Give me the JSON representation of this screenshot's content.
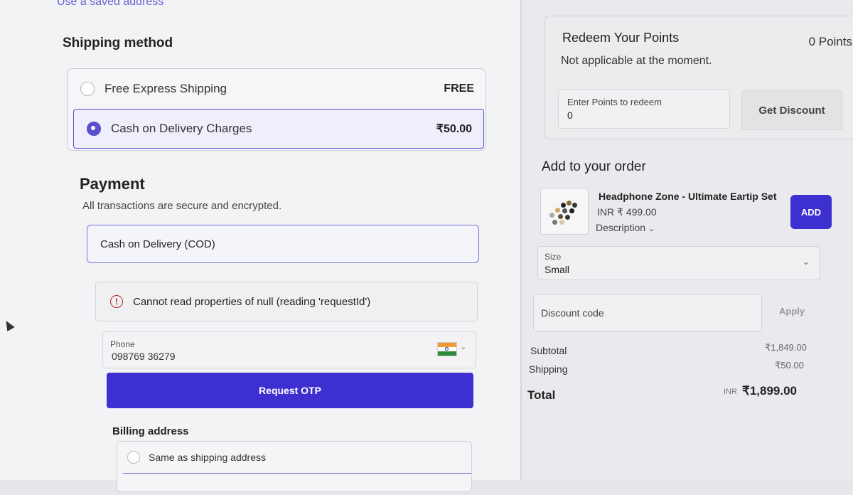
{
  "top_link": "Use a saved address",
  "shipping": {
    "title": "Shipping method",
    "options": [
      {
        "label": "Free Express Shipping",
        "price": "FREE",
        "selected": false
      },
      {
        "label": "Cash on Delivery Charges",
        "price": "₹50.00",
        "selected": true
      }
    ]
  },
  "payment": {
    "title": "Payment",
    "subtitle": "All transactions are secure and encrypted.",
    "method": "Cash on Delivery (COD)",
    "error": "Cannot read properties of null (reading 'requestId')",
    "phone_label": "Phone",
    "phone_value": "098769 36279",
    "request_otp": "Request OTP"
  },
  "billing": {
    "title": "Billing address",
    "option": "Same as shipping address"
  },
  "redeem": {
    "title": "Redeem Your Points",
    "points": "0 Points",
    "subtitle": "Not applicable at the moment.",
    "input_label": "Enter Points to redeem",
    "input_value": "0",
    "button": "Get Discount"
  },
  "upsell": {
    "title": "Add to your order",
    "product_name": "Headphone Zone - Ultimate Eartip Set",
    "price": "INR ₹ 499.00",
    "description": "Description",
    "add_button": "ADD",
    "size_label": "Size",
    "size_value": "Small"
  },
  "discount": {
    "placeholder": "Discount code",
    "apply": "Apply"
  },
  "summary": {
    "subtotal_label": "Subtotal",
    "subtotal": "₹1,849.00",
    "shipping_label": "Shipping",
    "shipping": "₹50.00",
    "total_label": "Total",
    "currency": "INR",
    "total": "₹1,899.00"
  },
  "colors": {
    "accent": "#3e2fd0",
    "error": "#b3261e"
  }
}
